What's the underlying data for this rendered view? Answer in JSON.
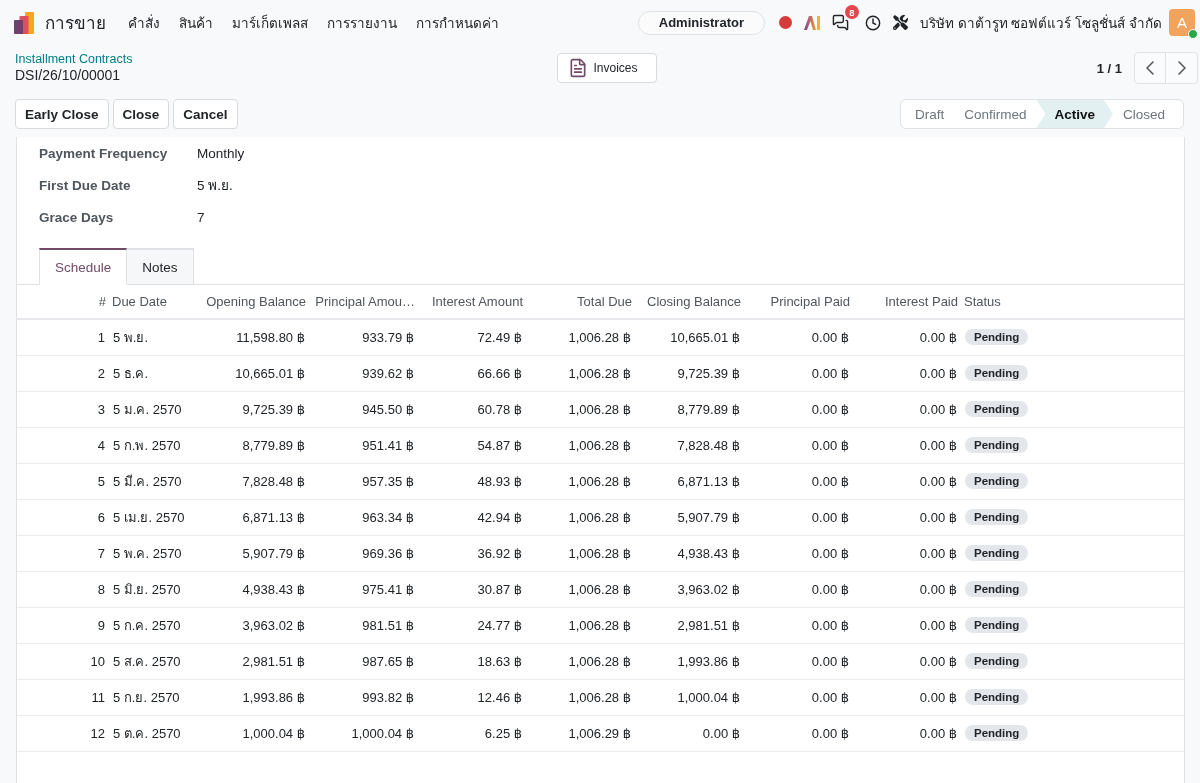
{
  "navbar": {
    "app_name": "การขาย",
    "menu": [
      "คำสั่ง",
      "สินค้า",
      "มาร์เก็ตเพลส",
      "การรายงาน",
      "การกำหนดค่า"
    ],
    "user": "Administrator",
    "message_count": "8",
    "company": "บริษัท ดาต้ารูท ซอฟต์แวร์ โซลูชั่นส์ จำกัด",
    "avatar": {
      "initial": "A",
      "online": true
    }
  },
  "breadcrumb": {
    "parent": "Installment Contracts",
    "current": "DSI/26/10/00001"
  },
  "smart_buttons": [
    {
      "label": "Invoices"
    }
  ],
  "pager": "1 / 1",
  "action_buttons": [
    "Early Close",
    "Close",
    "Cancel"
  ],
  "status_bar": [
    {
      "label": "Draft",
      "selected": false
    },
    {
      "label": "Confirmed",
      "selected": false
    },
    {
      "label": "Active",
      "selected": true
    },
    {
      "label": "Closed",
      "selected": false
    }
  ],
  "fields": [
    {
      "label": "Payment Frequency",
      "value": "Monthly"
    },
    {
      "label": "First Due Date",
      "value": "5 พ.ย."
    },
    {
      "label": "Grace Days",
      "value": "7"
    }
  ],
  "tabs": [
    {
      "label": "Schedule",
      "selected": true
    },
    {
      "label": "Notes",
      "selected": false
    }
  ],
  "table": {
    "columns": [
      "#",
      "Due Date",
      "Opening Balance",
      "Principal Amou…",
      "Interest Amount",
      "Total Due",
      "Closing Balance",
      "Principal Paid",
      "Interest Paid",
      "Status"
    ],
    "rows": [
      {
        "cells": [
          "1",
          "5 พ.ย.",
          "11,598.80 ฿",
          "933.79 ฿",
          "72.49 ฿",
          "1,006.28 ฿",
          "10,665.01 ฿",
          "0.00 ฿",
          "0.00 ฿"
        ],
        "status": "Pending"
      },
      {
        "cells": [
          "2",
          "5 ธ.ค.",
          "10,665.01 ฿",
          "939.62 ฿",
          "66.66 ฿",
          "1,006.28 ฿",
          "9,725.39 ฿",
          "0.00 ฿",
          "0.00 ฿"
        ],
        "status": "Pending"
      },
      {
        "cells": [
          "3",
          "5 ม.ค. 2570",
          "9,725.39 ฿",
          "945.50 ฿",
          "60.78 ฿",
          "1,006.28 ฿",
          "8,779.89 ฿",
          "0.00 ฿",
          "0.00 ฿"
        ],
        "status": "Pending"
      },
      {
        "cells": [
          "4",
          "5 ก.พ. 2570",
          "8,779.89 ฿",
          "951.41 ฿",
          "54.87 ฿",
          "1,006.28 ฿",
          "7,828.48 ฿",
          "0.00 ฿",
          "0.00 ฿"
        ],
        "status": "Pending"
      },
      {
        "cells": [
          "5",
          "5 มี.ค. 2570",
          "7,828.48 ฿",
          "957.35 ฿",
          "48.93 ฿",
          "1,006.28 ฿",
          "6,871.13 ฿",
          "0.00 ฿",
          "0.00 ฿"
        ],
        "status": "Pending"
      },
      {
        "cells": [
          "6",
          "5 เม.ย. 2570",
          "6,871.13 ฿",
          "963.34 ฿",
          "42.94 ฿",
          "1,006.28 ฿",
          "5,907.79 ฿",
          "0.00 ฿",
          "0.00 ฿"
        ],
        "status": "Pending"
      },
      {
        "cells": [
          "7",
          "5 พ.ค. 2570",
          "5,907.79 ฿",
          "969.36 ฿",
          "36.92 ฿",
          "1,006.28 ฿",
          "4,938.43 ฿",
          "0.00 ฿",
          "0.00 ฿"
        ],
        "status": "Pending"
      },
      {
        "cells": [
          "8",
          "5 มิ.ย. 2570",
          "4,938.43 ฿",
          "975.41 ฿",
          "30.87 ฿",
          "1,006.28 ฿",
          "3,963.02 ฿",
          "0.00 ฿",
          "0.00 ฿"
        ],
        "status": "Pending"
      },
      {
        "cells": [
          "9",
          "5 ก.ค. 2570",
          "3,963.02 ฿",
          "981.51 ฿",
          "24.77 ฿",
          "1,006.28 ฿",
          "2,981.51 ฿",
          "0.00 ฿",
          "0.00 ฿"
        ],
        "status": "Pending"
      },
      {
        "cells": [
          "10",
          "5 ส.ค. 2570",
          "2,981.51 ฿",
          "987.65 ฿",
          "18.63 ฿",
          "1,006.28 ฿",
          "1,993.86 ฿",
          "0.00 ฿",
          "0.00 ฿"
        ],
        "status": "Pending"
      },
      {
        "cells": [
          "11",
          "5 ก.ย. 2570",
          "1,993.86 ฿",
          "993.82 ฿",
          "12.46 ฿",
          "1,006.28 ฿",
          "1,000.04 ฿",
          "0.00 ฿",
          "0.00 ฿"
        ],
        "status": "Pending"
      },
      {
        "cells": [
          "12",
          "5 ต.ค. 2570",
          "1,000.04 ฿",
          "1,000.04 ฿",
          "6.25 ฿",
          "1,006.29 ฿",
          "0.00 ฿",
          "0.00 ฿",
          "0.00 ฿"
        ],
        "status": "Pending"
      }
    ]
  }
}
